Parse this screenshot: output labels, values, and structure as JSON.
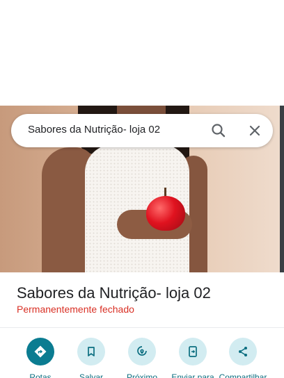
{
  "search": {
    "query": "Sabores da Nutrição- loja 02"
  },
  "place": {
    "name": "Sabores da Nutrição- loja 02",
    "status": "Permanentemente fechado"
  },
  "actions": [
    {
      "label": "Rotas",
      "icon": "directions-icon"
    },
    {
      "label": "Salvar",
      "icon": "bookmark-icon"
    },
    {
      "label": "Próximo",
      "icon": "nearby-icon"
    },
    {
      "label": "Enviar para",
      "icon": "send-to-phone-icon"
    },
    {
      "label": "Compartilhar",
      "icon": "share-icon"
    }
  ],
  "colors": {
    "accent": "#0b7c91",
    "accent_light": "#d2ecf1",
    "status_closed": "#d93025"
  }
}
